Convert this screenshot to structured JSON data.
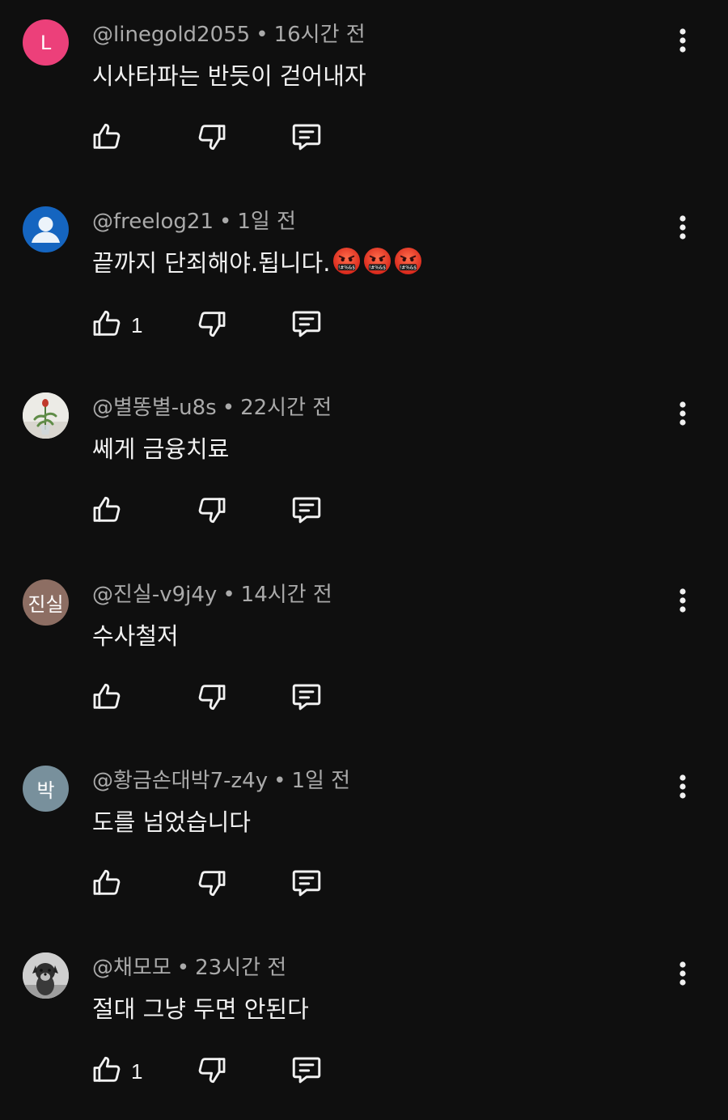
{
  "comments": [
    {
      "handle": "@linegold2055",
      "time": "16시간 전",
      "text": "시사타파는 반듯이 걷어내자",
      "likes": "",
      "avatar": {
        "type": "letter",
        "letter": "L",
        "color": "#ec407a"
      },
      "emojis": []
    },
    {
      "handle": "@freelog21",
      "time": "1일 전",
      "text": "끝까지 단죄해야.됩니다.",
      "likes": "1",
      "avatar": {
        "type": "default-person",
        "color": "#1565c0"
      },
      "emojis": [
        "cursing-face-emoji",
        "cursing-face-emoji",
        "cursing-face-emoji"
      ]
    },
    {
      "handle": "@별똥별-u8s",
      "time": "22시간 전",
      "text": "쎄게 금융치료",
      "likes": "",
      "avatar": {
        "type": "photo-flower"
      },
      "emojis": []
    },
    {
      "handle": "@진실-v9j4y",
      "time": "14시간 전",
      "text": "수사철저",
      "likes": "",
      "avatar": {
        "type": "letter",
        "letter": "진실",
        "color": "#8d6e63"
      },
      "emojis": []
    },
    {
      "handle": "@황금손대박7-z4y",
      "time": "1일 전",
      "text": "도를 넘었습니다",
      "likes": "",
      "avatar": {
        "type": "letter",
        "letter": "박",
        "color": "#78909c"
      },
      "emojis": []
    },
    {
      "handle": "@채모모",
      "time": "23시간 전",
      "text": "절대 그냥 두면 안된다",
      "likes": "1",
      "avatar": {
        "type": "photo-dog"
      },
      "emojis": []
    }
  ],
  "separator": "•",
  "icons": {
    "like": "thumbs-up-icon",
    "dislike": "thumbs-down-icon",
    "reply": "reply-comment-icon",
    "more": "more-vertical-icon"
  }
}
